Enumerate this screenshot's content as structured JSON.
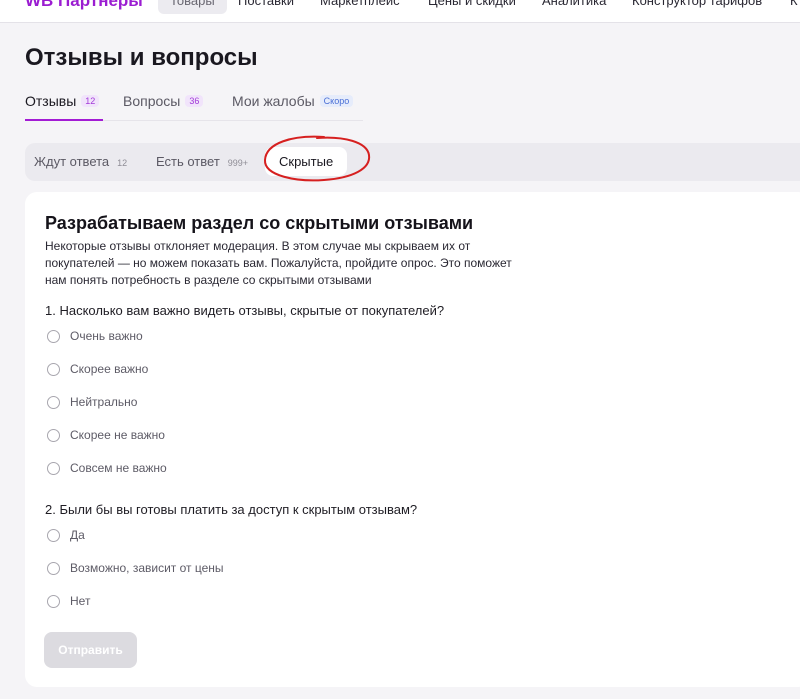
{
  "topnav": {
    "brand": "WB Партнеры",
    "items": [
      "Товары",
      "Поставки",
      "Маркетплейс",
      "Цены и скидки",
      "Аналитика",
      "Конструктор тарифов",
      "К"
    ]
  },
  "page": {
    "title": "Отзывы и вопросы"
  },
  "tabs": [
    {
      "label": "Отзывы",
      "badge": "12"
    },
    {
      "label": "Вопросы",
      "badge": "36"
    },
    {
      "label": "Мои жалобы",
      "badge": "Скоро"
    }
  ],
  "filters": [
    {
      "label": "Ждут ответа",
      "count": "12"
    },
    {
      "label": "Есть ответ",
      "count": "999+"
    },
    {
      "label": "Скрытые"
    }
  ],
  "survey": {
    "title": "Разрабатываем раздел со скрытыми отзывами",
    "description": "Некоторые отзывы отклоняет модерация. В этом случае мы скрываем их от покупателей — но можем показать вам. Пожалуйста, пройдите опрос. Это поможет нам понять потребность в разделе со скрытыми отзывами",
    "q1": {
      "text": "1. Насколько вам важно видеть отзывы, скрытые от покупателей?",
      "options": [
        "Очень важно",
        "Скорее важно",
        "Нейтрально",
        "Скорее не важно",
        "Совсем не важно"
      ]
    },
    "q2": {
      "text": "2. Были бы вы готовы платить за доступ к скрытым отзывам?",
      "options": [
        "Да",
        "Возможно, зависит от цены",
        "Нет"
      ]
    },
    "submit_label": "Отправить"
  },
  "colors": {
    "accent": "#a31bd4",
    "annotation": "#d62020",
    "card_background": "#ffffff",
    "page_background": "#f5f4f7"
  }
}
